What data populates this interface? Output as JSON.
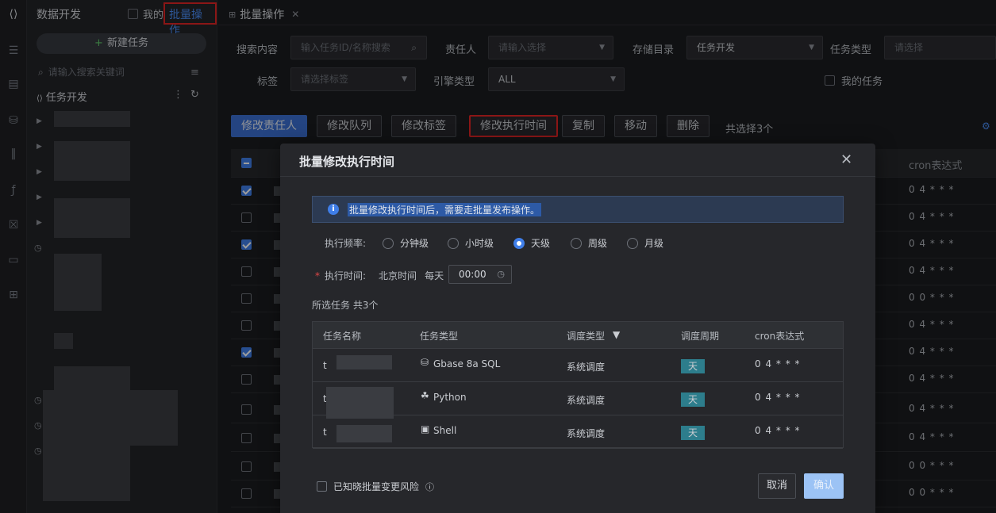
{
  "sidebar": {
    "title": "数据开发",
    "mine_label": "我的",
    "batch_label": "批量操作",
    "new_task": "新建任务",
    "search_placeholder": "请输入搜索关键词",
    "folder": "任务开发"
  },
  "tab": {
    "label": "批量操作"
  },
  "filters": {
    "search_label": "搜索内容",
    "search_placeholder": "输入任务ID/名称搜索",
    "owner_label": "责任人",
    "owner_placeholder": "请输入选择",
    "dir_label": "存储目录",
    "dir_value": "任务开发",
    "type_label": "任务类型",
    "type_placeholder": "请选择",
    "tag_label": "标签",
    "tag_placeholder": "请选择标签",
    "engine_label": "引擎类型",
    "engine_value": "ALL",
    "my_task": "我的任务"
  },
  "actions": {
    "owner": "修改责任人",
    "queue": "修改队列",
    "tag": "修改标签",
    "time": "修改执行时间",
    "copy": "复制",
    "move": "移动",
    "delete": "删除",
    "selected": "共选择3个"
  },
  "table": {
    "cron_header": "cron表达式",
    "rows": [
      {
        "checked": true,
        "cron": "0 4 * * *"
      },
      {
        "checked": false,
        "cron": "0 4 * * *"
      },
      {
        "checked": true,
        "cron": "0 4 * * *"
      },
      {
        "checked": false,
        "cron": "0 4 * * *"
      },
      {
        "checked": false,
        "cron": "0 0 * * *"
      },
      {
        "checked": false,
        "cron": "0 4 * * *"
      },
      {
        "checked": true,
        "cron": "0 4 * * *"
      },
      {
        "checked": false,
        "cron": "0 4 * * *"
      },
      {
        "checked": false,
        "cron": "0 4 * * *"
      },
      {
        "checked": false,
        "cron": "0 4 * * *"
      },
      {
        "checked": false,
        "cron": "0 0 * * *"
      },
      {
        "checked": false,
        "cron": "0 0 * * *"
      }
    ]
  },
  "modal": {
    "title": "批量修改执行时间",
    "alert": "批量修改执行时间后，需要走批量发布操作。",
    "freq_label": "执行频率:",
    "freq_options": [
      "分钟级",
      "小时级",
      "天级",
      "周级",
      "月级"
    ],
    "freq_selected": "天级",
    "time_label": "执行时间:",
    "timezone": "北京时间",
    "every_day": "每天",
    "time_value": "00:00",
    "selected_title": "所选任务 共3个",
    "columns": {
      "name": "任务名称",
      "type": "任务类型",
      "sched": "调度类型",
      "period": "调度周期",
      "cron": "cron表达式"
    },
    "rows": [
      {
        "name_prefix": "t",
        "type": "Gbase 8a SQL",
        "type_icon": "database-icon",
        "sched": "系统调度",
        "period": "天",
        "cron": "0 4 * * *"
      },
      {
        "name_prefix": "t",
        "type": "Python",
        "type_icon": "python-icon",
        "sched": "系统调度",
        "period": "天",
        "cron": "0 4 * * *"
      },
      {
        "name_prefix": "t",
        "type": "Shell",
        "type_icon": "terminal-icon",
        "sched": "系统调度",
        "period": "天",
        "cron": "0 4 * * *"
      }
    ],
    "risk_label": "已知晓批量变更风险",
    "cancel": "取消",
    "confirm": "确认"
  }
}
